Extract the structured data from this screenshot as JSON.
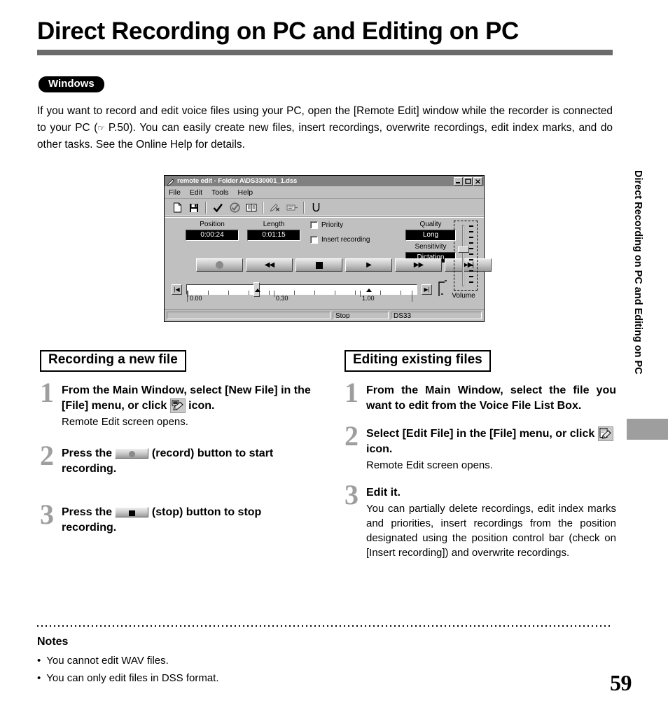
{
  "page": {
    "title": "Direct Recording on PC and Editing on PC",
    "os_badge": "Windows",
    "page_number": "59",
    "side_tab": "Direct Recording on PC and Editing on PC"
  },
  "intro": {
    "part1": "If you want to record and edit voice files using your PC, open the [Remote Edit] window while the recorder is connected to your PC (",
    "pointer_icon": "☞",
    "part2": " P.50). You can easily create new files, insert recordings, overwrite recordings, edit index marks, and do other tasks. See the Online Help for details."
  },
  "app_window": {
    "title": "remote edit - Folder A\\DS330001_1.dss",
    "title_icon": "pencil-icon",
    "window_buttons": [
      "minimize",
      "maximize",
      "close"
    ],
    "menus": [
      "File",
      "Edit",
      "Tools",
      "Help"
    ],
    "toolbar_icons": [
      "new-file-icon",
      "save-icon",
      "check-icon",
      "check-circle-icon",
      "book-icon",
      "pen-delete-icon",
      "insert-icon",
      "undo-icon"
    ],
    "fields": {
      "position_label": "Position",
      "position_value": "0:00:24",
      "length_label": "Length",
      "length_value": "0:01:15",
      "quality_label": "Quality",
      "quality_value": "Long",
      "sensitivity_label": "Sensitivity",
      "sensitivity_value": "Dictation"
    },
    "checkboxes": [
      {
        "label": "Priority",
        "checked": false
      },
      {
        "label": "Insert recording",
        "checked": false
      }
    ],
    "transport_buttons": [
      {
        "name": "record",
        "glyph": ""
      },
      {
        "name": "rewind",
        "glyph": "◀◀"
      },
      {
        "name": "stop",
        "glyph": ""
      },
      {
        "name": "play",
        "glyph": "▶"
      },
      {
        "name": "fast-forward",
        "glyph": "▶▶"
      },
      {
        "name": "skip-next",
        "glyph": "▶▶|"
      }
    ],
    "seek": {
      "skip_start_glyph": "|◀",
      "skip_end_glyph": "▶|"
    },
    "ruler_labels": [
      "0.00",
      "0.30",
      "1.00"
    ],
    "volume_caption": "Volume",
    "status": {
      "message": "",
      "state": "Stop",
      "device": "DS33"
    }
  },
  "sections": {
    "left": {
      "heading": "Recording a new file",
      "steps": [
        {
          "num": "1",
          "title_a": "From the Main Window, select [New File] in the [File] menu, or click ",
          "icon": "remote-edit-icon",
          "title_b": " icon.",
          "body": "Remote Edit screen opens."
        },
        {
          "num": "2",
          "title_a": "Press the ",
          "icon": "record-button-icon",
          "title_b": " (record) button to start recording.",
          "body": ""
        },
        {
          "num": "3",
          "title_a": "Press the ",
          "icon": "stop-button-icon",
          "title_b": " (stop) button to stop recording.",
          "body": ""
        }
      ]
    },
    "right": {
      "heading": "Editing existing files",
      "steps": [
        {
          "num": "1",
          "title_a": "From the Main Window, select the file you want to edit from the Voice File List Box.",
          "icon": "",
          "title_b": "",
          "body": ""
        },
        {
          "num": "2",
          "title_a": "Select [Edit File] in the [File] menu, or click ",
          "icon": "edit-file-icon",
          "title_b": " icon.",
          "body": "Remote Edit screen opens."
        },
        {
          "num": "3",
          "title_a": "Edit it.",
          "icon": "",
          "title_b": "",
          "body": "You can partially delete recordings, edit index marks and priorities, insert recordings from the position designated using the position control bar (check on [Insert recording]) and overwrite recordings."
        }
      ]
    }
  },
  "notes": {
    "heading": "Notes",
    "bullet": "•",
    "items": [
      "You cannot edit WAV files.",
      "You can only edit files in DSS format."
    ]
  }
}
